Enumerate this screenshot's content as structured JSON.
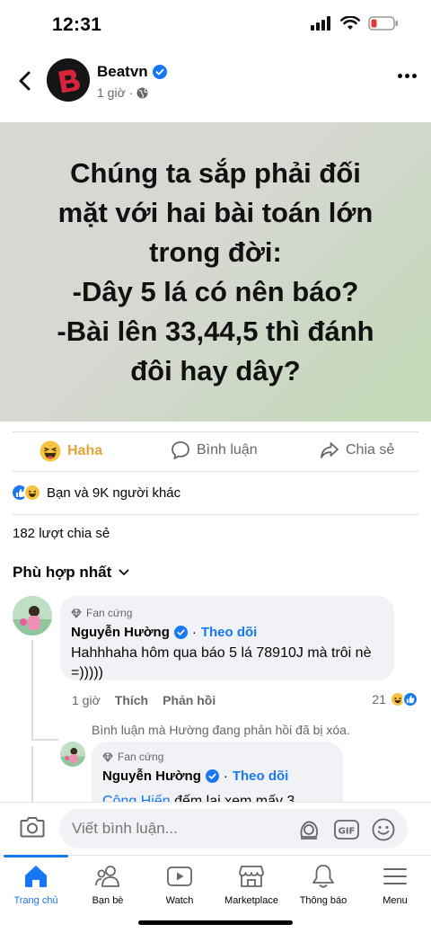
{
  "status": {
    "time": "12:31"
  },
  "post": {
    "page_name": "Beatvn",
    "time": "1 giờ",
    "text": "Chúng ta sắp phải đối\nmặt với hai bài toán lớn\ntrong đời:\n-Dây 5 lá có nên báo?\n-Bài lên 33,44,5 thì đánh\nđôi hay dây?"
  },
  "actions": {
    "haha": "Haha",
    "comment": "Bình luận",
    "share": "Chia sẻ"
  },
  "reactions_text": "Bạn và 9K người khác",
  "share_count": "182 lượt chia sẻ",
  "sort_label": "Phù hợp nhất",
  "comment1": {
    "badge": "Fan cứng",
    "name": "Nguyễn Hường",
    "follow": "Theo dõi",
    "text": "Hahhhaha hôm qua báo 5 lá 78910J mà trôi nè =)))))",
    "time": "1 giờ",
    "like": "Thích",
    "reply": "Phản hồi",
    "react_count": "21"
  },
  "deleted_note": "Bình luận mà Hường đang phản hồi đã bị xóa.",
  "comment2": {
    "badge": "Fan cứng",
    "name": "Nguyễn Hường",
    "follow": "Theo dõi",
    "mention": "Công Hiến",
    "text": "đếm lại xem mấy 3"
  },
  "input": {
    "placeholder": "Viết bình luận..."
  },
  "tabs": [
    {
      "label": "Trang chủ"
    },
    {
      "label": "Bạn bè"
    },
    {
      "label": "Watch"
    },
    {
      "label": "Marketplace"
    },
    {
      "label": "Thông báo"
    },
    {
      "label": "Menu"
    }
  ],
  "colors": {
    "accent": "#1877f2",
    "haha": "#e8a33a"
  }
}
